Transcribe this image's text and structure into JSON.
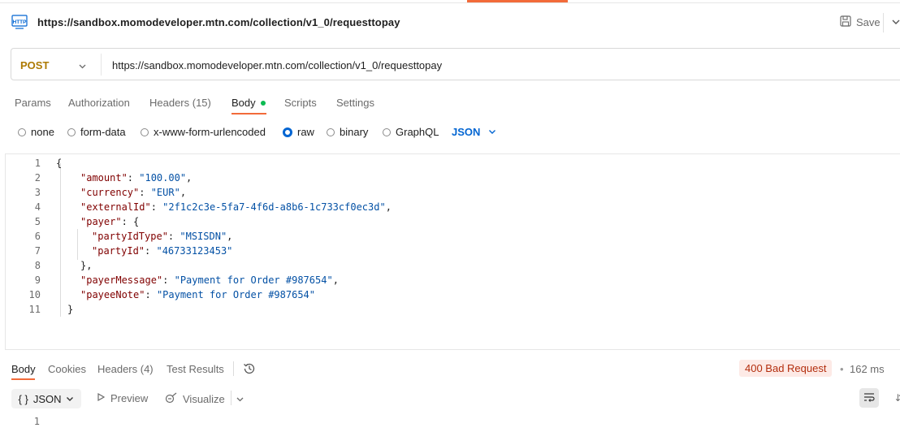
{
  "tab": {
    "title": "https://sandbox.momodeveloper.mtn.com/collection/v1_0/requesttopay",
    "icon": "http-icon",
    "save_label": "Save"
  },
  "request": {
    "method": "POST",
    "url": "https://sandbox.momodeveloper.mtn.com/collection/v1_0/requesttopay",
    "tabs": [
      "Params",
      "Authorization",
      "Headers (15)",
      "Body",
      "Scripts",
      "Settings"
    ],
    "active_tab": "Body",
    "body_types": [
      "none",
      "form-data",
      "x-www-form-urlencoded",
      "raw",
      "binary",
      "GraphQL"
    ],
    "selected_body_type": "raw",
    "format": "JSON"
  },
  "editor": {
    "line_numbers": [
      "1",
      "2",
      "3",
      "4",
      "5",
      "6",
      "7",
      "8",
      "9",
      "10",
      "11"
    ],
    "lines": {
      "l1": "{",
      "l2": {
        "key": "\"amount\"",
        "sep": ": ",
        "val": "\"100.00\"",
        "end": ","
      },
      "l3": {
        "key": "\"currency\"",
        "sep": ": ",
        "val": "\"EUR\"",
        "end": ","
      },
      "l4": {
        "key": "\"externalId\"",
        "sep": ": ",
        "val": "\"2f1c2c3e-5fa7-4f6d-a8b6-1c733cf0ec3d\"",
        "end": ","
      },
      "l5": {
        "key": "\"payer\"",
        "sep": ": ",
        "end": "{"
      },
      "l6": {
        "key": "\"partyIdType\"",
        "sep": ": ",
        "val": "\"MSISDN\"",
        "end": ","
      },
      "l7": {
        "key": "\"partyId\"",
        "sep": ": ",
        "val": "\"46733123453\""
      },
      "l8": "},",
      "l9": {
        "key": "\"payerMessage\"",
        "sep": ": ",
        "val": "\"Payment for Order #987654\"",
        "end": ","
      },
      "l10": {
        "key": "\"payeeNote\"",
        "sep": ": ",
        "val": "\"Payment for Order #987654\""
      },
      "l11": "}"
    }
  },
  "response": {
    "tabs": [
      "Body",
      "Cookies",
      "Headers (4)",
      "Test Results"
    ],
    "active_tab": "Body",
    "status": "400 Bad Request",
    "status_color": "#b32e0e",
    "time": "162 ms",
    "format": "JSON",
    "format_prefix": "{ }",
    "preview_label": "Preview",
    "visualize_label": "Visualize",
    "line_number": "1"
  },
  "colors": {
    "accent": "#f26b3a",
    "method": "#ad7a03",
    "link": "#0265d2",
    "body_dot": "#0cbb52"
  }
}
